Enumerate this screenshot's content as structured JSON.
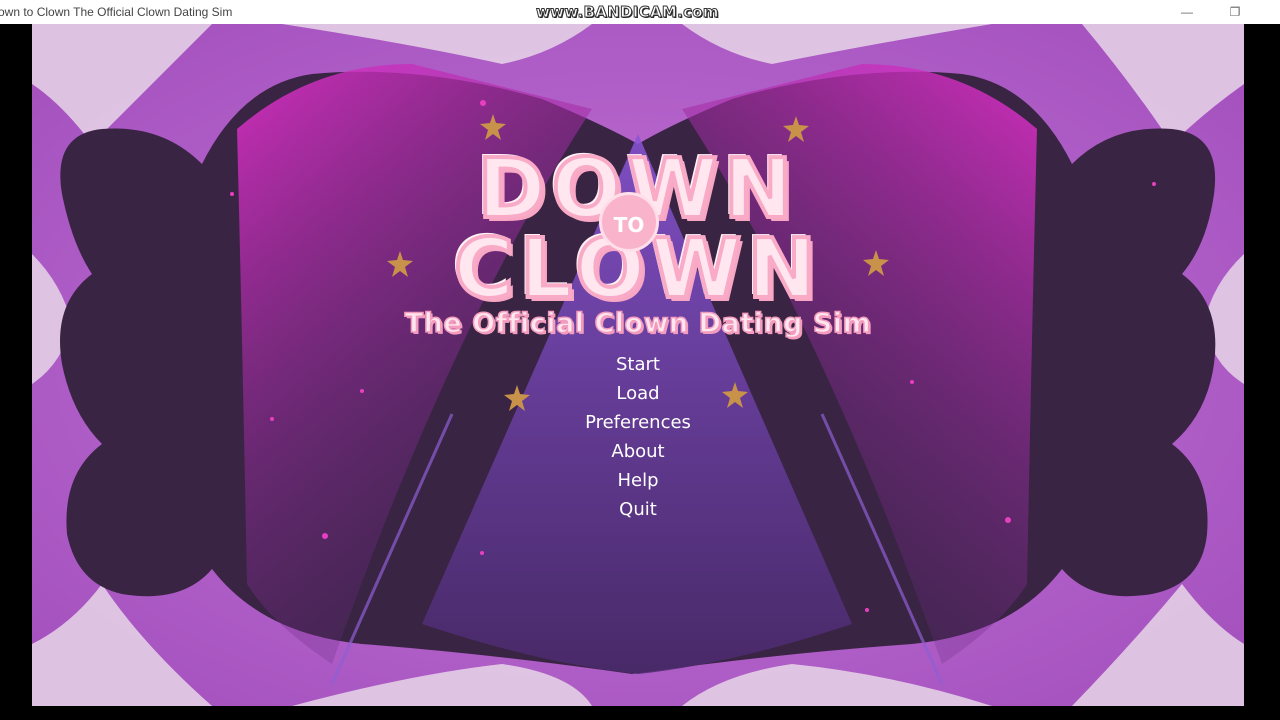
{
  "window": {
    "title": "own to Clown The Official Clown Dating Sim",
    "watermark": "www.BANDICAM.com",
    "minimize_glyph": "—",
    "maximize_glyph": "❐"
  },
  "game": {
    "logo": {
      "line1": "DOWN",
      "connector": "TO",
      "line2": "CLOWN",
      "subtitle": "The Official Clown Dating Sim"
    },
    "menu": [
      {
        "label": "Start"
      },
      {
        "label": "Load"
      },
      {
        "label": "Preferences"
      },
      {
        "label": "About"
      },
      {
        "label": "Help"
      },
      {
        "label": "Quit"
      }
    ],
    "colors": {
      "background_purple": "#b561c9",
      "dark_panel": "#3a2444",
      "spotlight_magenta": "#d22fc4",
      "logo_pink": "#f8aac6",
      "star_gold": "#c9924a"
    }
  }
}
